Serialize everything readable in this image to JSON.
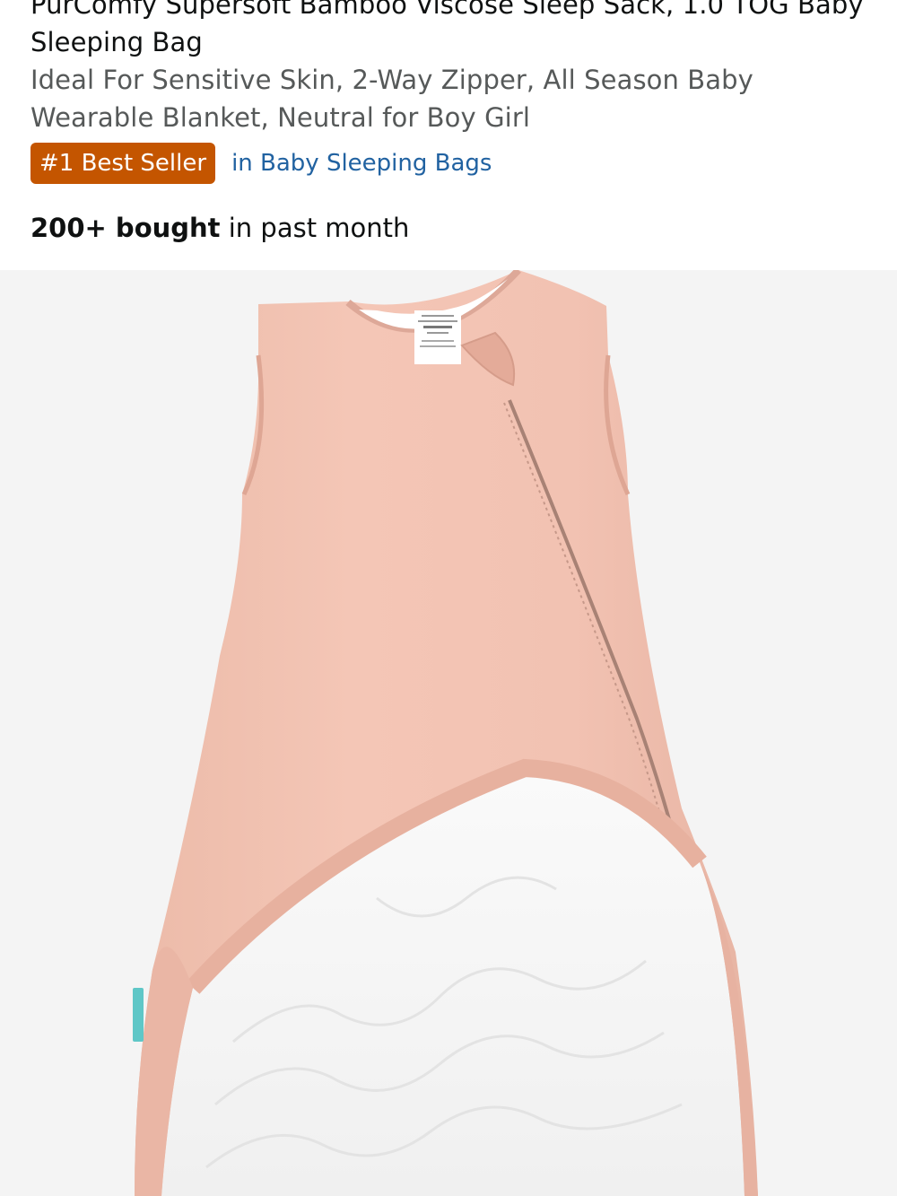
{
  "product": {
    "title": "PurComfy Supersoft Bamboo Viscose Sleep Sack, 1.0 TOG Baby Sleeping Bag",
    "subtitle": "Ideal For Sensitive Skin, 2-Way Zipper, All Season Baby Wearable Blanket, Neutral for Boy Girl"
  },
  "badge": {
    "label": "#1 Best Seller",
    "category_link": "in Baby Sleeping Bags",
    "badge_color": "#c45500",
    "link_color": "#2162a1"
  },
  "purchases": {
    "count": "200+ bought",
    "suffix": " in past month"
  },
  "image": {
    "alt": "Pink sleeveless baby sleep sack with diagonal zipper, partially unzipped showing white quilted lining",
    "background_color": "#f4f4f4",
    "fabric_color": "#f2c3b3",
    "lining_color": "#ffffff"
  }
}
